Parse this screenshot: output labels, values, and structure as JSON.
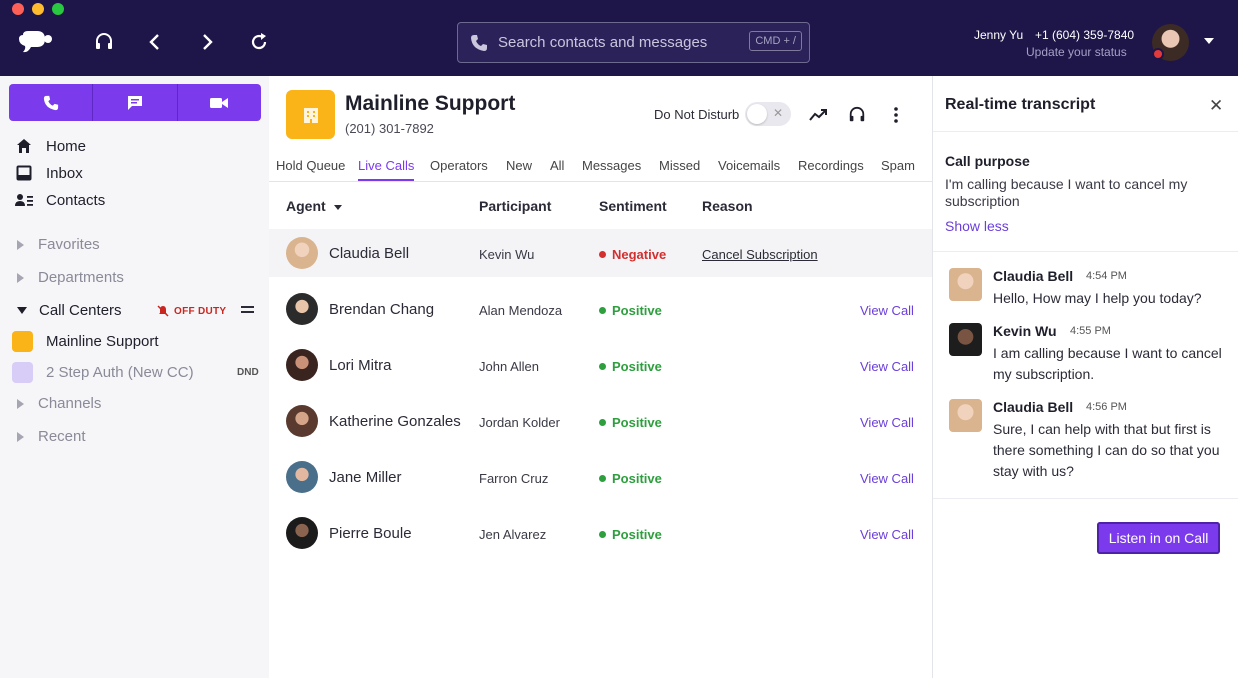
{
  "colors": {
    "topbar": "#1e1548",
    "accent": "#7c3aed",
    "negative": "#d32f2f",
    "positive": "#2e9e3e",
    "cc_primary": "#fbb417",
    "cc_secondary": "#d8cdf7"
  },
  "topbar": {
    "search_placeholder": "Search contacts and messages",
    "search_shortcut": "CMD + /",
    "user_name": "Jenny Yu",
    "user_phone": "+1 (604) 359-7840",
    "user_status": "Update your status"
  },
  "sidebar": {
    "nav": [
      {
        "label": "Home",
        "icon": "home-icon"
      },
      {
        "label": "Inbox",
        "icon": "inbox-icon"
      },
      {
        "label": "Contacts",
        "icon": "contacts-icon"
      }
    ],
    "sections": {
      "favorites": "Favorites",
      "departments": "Departments",
      "call_centers": "Call Centers",
      "channels": "Channels",
      "recent": "Recent"
    },
    "off_duty": "OFF DUTY",
    "call_centers": [
      {
        "label": "Mainline Support"
      },
      {
        "label": "2 Step Auth (New CC)",
        "tag": "DND"
      }
    ]
  },
  "main": {
    "title": "Mainline Support",
    "phone": "(201) 301-7892",
    "dnd_label": "Do Not Disturb",
    "tabs": [
      "Hold Queue",
      "Live Calls",
      "Operators",
      "New",
      "All",
      "Messages",
      "Missed",
      "Voicemails",
      "Recordings",
      "Spam"
    ],
    "columns": {
      "agent": "Agent",
      "participant": "Participant",
      "sentiment": "Sentiment",
      "reason": "Reason"
    },
    "rows": [
      {
        "agent": "Claudia Bell",
        "participant": "Kevin Wu",
        "sentiment": "Negative",
        "reason": "Cancel Subscription",
        "action": ""
      },
      {
        "agent": "Brendan Chang",
        "participant": "Alan Mendoza",
        "sentiment": "Positive",
        "reason": "",
        "action": "View Call"
      },
      {
        "agent": "Lori Mitra",
        "participant": "John Allen",
        "sentiment": "Positive",
        "reason": "",
        "action": "View Call"
      },
      {
        "agent": "Katherine Gonzales",
        "participant": "Jordan Kolder",
        "sentiment": "Positive",
        "reason": "",
        "action": "View Call"
      },
      {
        "agent": "Jane Miller",
        "participant": "Farron Cruz",
        "sentiment": "Positive",
        "reason": "",
        "action": "View Call"
      },
      {
        "agent": "Pierre Boule",
        "participant": "Jen Alvarez",
        "sentiment": "Positive",
        "reason": "",
        "action": "View Call"
      }
    ]
  },
  "transcript": {
    "title": "Real-time transcript",
    "purpose_title": "Call purpose",
    "purpose_text": "I'm calling because I want to cancel my subscription",
    "show_less": "Show less",
    "messages": [
      {
        "name": "Claudia Bell",
        "time": "4:54 PM",
        "text": "Hello, How may I help you today?"
      },
      {
        "name": "Kevin Wu",
        "time": "4:55 PM",
        "text": "I am calling because I want to cancel my subscription."
      },
      {
        "name": "Claudia Bell",
        "time": "4:56 PM",
        "text": "Sure, I can help with that but first is there something I can do so that you stay with us?"
      }
    ],
    "listen_button": "Listen in on Call"
  }
}
